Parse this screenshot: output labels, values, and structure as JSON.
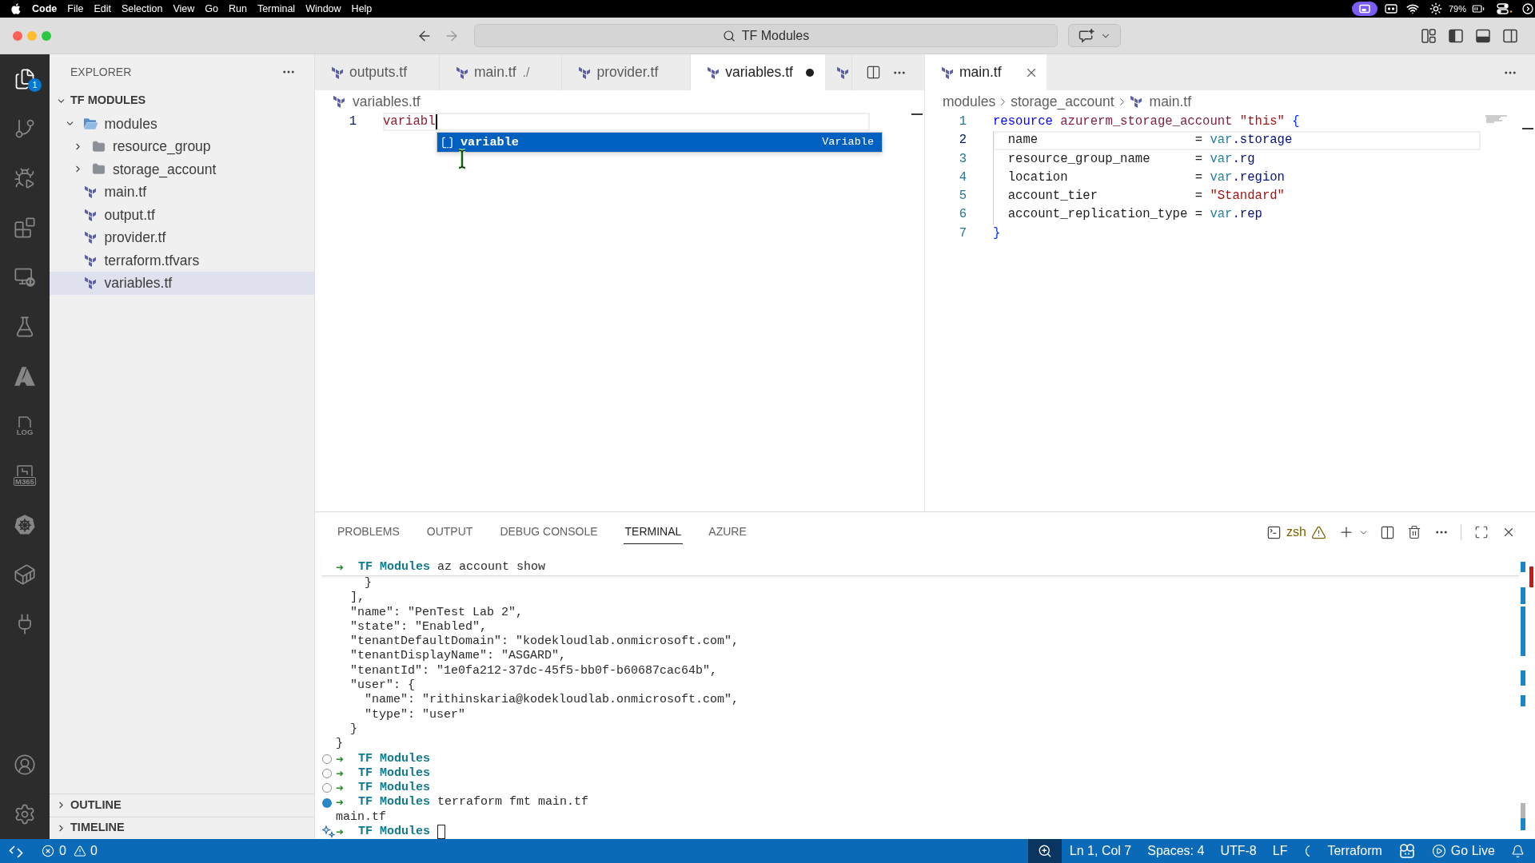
{
  "menu_bar": {
    "app": "Code",
    "items": [
      "File",
      "Edit",
      "Selection",
      "View",
      "Go",
      "Run",
      "Terminal",
      "Window",
      "Help"
    ],
    "battery": "79%"
  },
  "title_bar": {
    "search": "TF Modules",
    "layout_toggles": [
      {
        "kind": "customize"
      },
      {
        "kind": "primary-sidebar",
        "on": true
      },
      {
        "kind": "panel",
        "on": true
      },
      {
        "kind": "secondary-sidebar",
        "on": false
      }
    ]
  },
  "activity_bar": {
    "items": [
      {
        "kind": "explorer",
        "selected": true,
        "badge": "1"
      },
      {
        "kind": "source-control",
        "selected": false
      },
      {
        "kind": "run-debug",
        "selected": false
      },
      {
        "kind": "extensions",
        "selected": false
      },
      {
        "kind": "remote-explorer",
        "selected": false
      },
      {
        "kind": "testing",
        "selected": false
      },
      {
        "kind": "azure",
        "selected": false
      },
      {
        "kind": "log",
        "selected": false,
        "label": "LOG"
      },
      {
        "kind": "m365",
        "selected": false,
        "label": "M365"
      },
      {
        "kind": "kubernetes",
        "selected": false
      },
      {
        "kind": "containers",
        "selected": false
      },
      {
        "kind": "plug",
        "selected": false
      }
    ],
    "bottom": [
      {
        "kind": "account"
      },
      {
        "kind": "settings"
      }
    ]
  },
  "sidebar": {
    "title": "EXPLORER",
    "tree": [
      {
        "label": "TF MODULES",
        "kind": "root",
        "expanded": true,
        "selected": false,
        "children": [
          {
            "label": "modules",
            "kind": "folder",
            "expanded": true,
            "selected": false,
            "children": [
              {
                "label": "resource_group",
                "kind": "folder",
                "expanded": false,
                "selected": false
              },
              {
                "label": "storage_account",
                "kind": "folder",
                "expanded": false,
                "selected": false
              }
            ]
          },
          {
            "label": "main.tf",
            "kind": "file",
            "selected": false
          },
          {
            "label": "output.tf",
            "kind": "file",
            "selected": false
          },
          {
            "label": "provider.tf",
            "kind": "file",
            "selected": false
          },
          {
            "label": "terraform.tfvars",
            "kind": "file",
            "selected": false
          },
          {
            "label": "variables.tf",
            "kind": "file",
            "selected": true
          }
        ]
      }
    ],
    "sections": [
      {
        "label": "OUTLINE",
        "expanded": false
      },
      {
        "label": "TIMELINE",
        "expanded": false
      }
    ]
  },
  "editor_groups": [
    {
      "tabs": [
        {
          "kind": "file",
          "label": "outputs.tf",
          "selected": false,
          "dirty": false
        },
        {
          "kind": "file",
          "label": "main.tf",
          "description": "./",
          "selected": false,
          "dirty": false
        },
        {
          "kind": "file",
          "label": "provider.tf",
          "selected": false,
          "dirty": false
        },
        {
          "kind": "file",
          "label": "variables.tf",
          "selected": true,
          "dirty": true
        },
        {
          "kind": "clipped",
          "selected": false
        }
      ],
      "actions": [
        {
          "kind": "split-editor"
        },
        {
          "kind": "more"
        }
      ],
      "breadcrumbs": [
        {
          "kind": "file",
          "label": "variables.tf"
        }
      ],
      "lines": [
        {
          "number": "1",
          "current": true,
          "cursor": true,
          "tokens": [
            {
              "kind": "identifier",
              "text": "variabl"
            }
          ]
        }
      ],
      "suggest": [
        {
          "label": "variable",
          "detail": "Variable",
          "selected": true
        }
      ]
    },
    {
      "tabs": [
        {
          "kind": "file",
          "label": "main.tf",
          "selected": true,
          "dirty": false
        }
      ],
      "actions": [
        {
          "kind": "more"
        }
      ],
      "breadcrumbs": [
        {
          "kind": "folder",
          "label": "modules"
        },
        {
          "kind": "folder",
          "label": "storage_account"
        },
        {
          "kind": "file",
          "label": "main.tf"
        }
      ],
      "lines": [
        {
          "number": "1",
          "current": false,
          "tokens": [
            {
              "kind": "keyword",
              "text": "resource "
            },
            {
              "kind": "label",
              "text": "azurerm_storage_account "
            },
            {
              "kind": "string",
              "text": "\"this\" "
            },
            {
              "kind": "bracket",
              "text": "{"
            }
          ]
        },
        {
          "number": "2",
          "current": true,
          "indent_guide": true,
          "tokens": [
            {
              "kind": "plain",
              "text": "  name                     = "
            },
            {
              "kind": "variable",
              "text": "var"
            },
            {
              "kind": "property",
              "text": ".storage"
            }
          ]
        },
        {
          "number": "3",
          "current": false,
          "indent_guide": true,
          "tokens": [
            {
              "kind": "plain",
              "text": "  resource_group_name      = "
            },
            {
              "kind": "variable",
              "text": "var"
            },
            {
              "kind": "property",
              "text": ".rg"
            }
          ]
        },
        {
          "number": "4",
          "current": false,
          "indent_guide": true,
          "tokens": [
            {
              "kind": "plain",
              "text": "  location                 = "
            },
            {
              "kind": "variable",
              "text": "var"
            },
            {
              "kind": "property",
              "text": ".region"
            }
          ]
        },
        {
          "number": "5",
          "current": false,
          "indent_guide": true,
          "tokens": [
            {
              "kind": "plain",
              "text": "  account_tier             = "
            },
            {
              "kind": "string",
              "text": "\"Standard\""
            }
          ]
        },
        {
          "number": "6",
          "current": false,
          "indent_guide": true,
          "tokens": [
            {
              "kind": "plain",
              "text": "  account_replication_type = "
            },
            {
              "kind": "variable",
              "text": "var"
            },
            {
              "kind": "property",
              "text": ".rep"
            }
          ]
        },
        {
          "number": "7",
          "current": false,
          "tokens": [
            {
              "kind": "bracket",
              "text": "}"
            }
          ]
        }
      ]
    }
  ],
  "panel": {
    "tabs": [
      {
        "label": "PROBLEMS",
        "selected": false
      },
      {
        "label": "OUTPUT",
        "selected": false
      },
      {
        "label": "DEBUG CONSOLE",
        "selected": false
      },
      {
        "label": "TERMINAL",
        "selected": true
      },
      {
        "label": "AZURE",
        "selected": false
      }
    ],
    "terminal": {
      "name": "zsh",
      "warning": true,
      "sticky": {
        "kind": "prompt",
        "arrow": "➜",
        "dir": "TF Modules",
        "command": "az account show"
      },
      "lines": [
        {
          "kind": "output",
          "text": "    }"
        },
        {
          "kind": "output",
          "text": "  ],"
        },
        {
          "kind": "output",
          "text": "  \"name\": \"PenTest Lab 2\","
        },
        {
          "kind": "output",
          "text": "  \"state\": \"Enabled\","
        },
        {
          "kind": "output",
          "text": "  \"tenantDefaultDomain\": \"kodekloudlab.onmicrosoft.com\","
        },
        {
          "kind": "output",
          "text": "  \"tenantDisplayName\": \"ASGARD\","
        },
        {
          "kind": "output",
          "text": "  \"tenantId\": \"1e0fa212-37dc-45f5-bb0f-b60687cac64b\","
        },
        {
          "kind": "output",
          "text": "  \"user\": {"
        },
        {
          "kind": "output",
          "text": "    \"name\": \"rithinskaria@kodekloudlab.onmicrosoft.com\","
        },
        {
          "kind": "output",
          "text": "    \"type\": \"user\""
        },
        {
          "kind": "output",
          "text": "  }"
        },
        {
          "kind": "output",
          "text": "}"
        },
        {
          "kind": "prompt",
          "decoration": {
            "kind": "empty"
          },
          "arrow": "➜",
          "dir": "TF Modules"
        },
        {
          "kind": "prompt",
          "decoration": {
            "kind": "empty"
          },
          "arrow": "➜",
          "dir": "TF Modules"
        },
        {
          "kind": "prompt",
          "decoration": {
            "kind": "empty"
          },
          "arrow": "➜",
          "dir": "TF Modules"
        },
        {
          "kind": "prompt",
          "decoration": {
            "kind": "success"
          },
          "arrow": "➜",
          "dir": "TF Modules",
          "command": "terraform fmt main.tf"
        },
        {
          "kind": "output",
          "text": "main.tf"
        },
        {
          "kind": "prompt",
          "decoration": {
            "kind": "sparkle"
          },
          "arrow": "➜",
          "dir": "TF Modules",
          "cursor": true
        }
      ]
    }
  },
  "status_bar": {
    "errors": "0",
    "warnings": "0",
    "items": [
      {
        "kind": "zoom"
      },
      {
        "kind": "text",
        "label": "Ln 1, Col 7"
      },
      {
        "kind": "text",
        "label": "Spaces: 4"
      },
      {
        "kind": "text",
        "label": "UTF-8"
      },
      {
        "kind": "text",
        "label": "LF"
      },
      {
        "kind": "language-status"
      },
      {
        "kind": "text",
        "label": "Terraform"
      },
      {
        "kind": "copilot"
      },
      {
        "kind": "go-live",
        "label": "Go Live"
      },
      {
        "kind": "notifications"
      }
    ]
  }
}
